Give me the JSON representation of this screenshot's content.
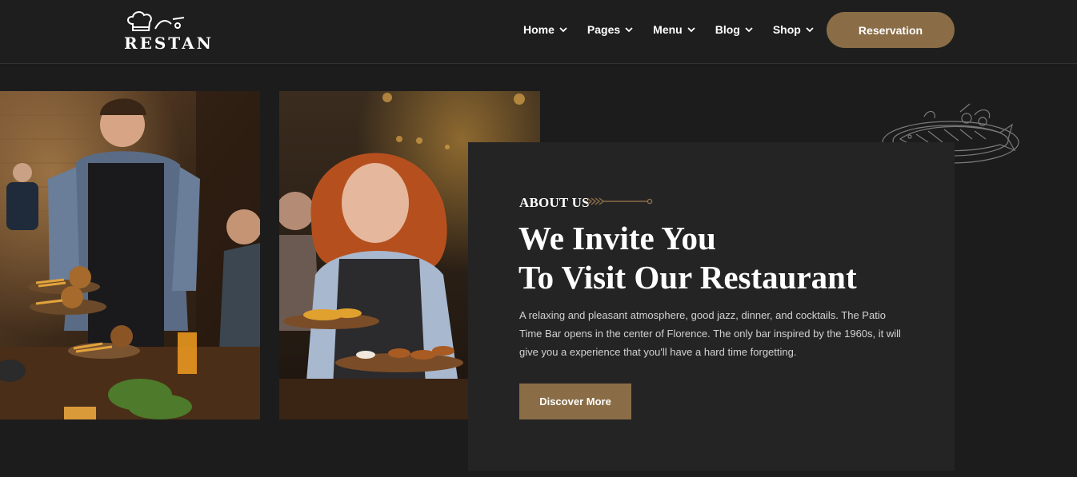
{
  "header": {
    "logo_text": "RESTAN",
    "logo_icon": "chef-hat-icon",
    "nav": [
      {
        "label": "Home",
        "icon": "chevron-down-icon"
      },
      {
        "label": "Pages",
        "icon": "chevron-down-icon"
      },
      {
        "label": "Menu",
        "icon": "chevron-down-icon"
      },
      {
        "label": "Blog",
        "icon": "chevron-down-icon"
      },
      {
        "label": "Shop",
        "icon": "chevron-down-icon"
      }
    ],
    "reservation_label": "Reservation"
  },
  "gallery": {
    "images": [
      {
        "name": "waiter-serving-burgers-photo"
      },
      {
        "name": "waitress-holding-plates-photo"
      }
    ]
  },
  "about": {
    "label": "ABOUT US",
    "title_line1": "We Invite You",
    "title_line2": "To Visit Our Restaurant",
    "description": "A relaxing and pleasant atmosphere, good jazz, dinner, and cocktails. The Patio Time Bar opens in the center of Florence. The only bar inspired by the 1960s, it will give you a experience that you'll have a hard time forgetting.",
    "button_label": "Discover More",
    "decoration_icon": "fish-platter-icon"
  },
  "colors": {
    "background": "#1c1c1c",
    "card": "#252425",
    "accent": "#8a6d47",
    "text": "#ffffff",
    "muted_text": "#d2d2d2"
  }
}
